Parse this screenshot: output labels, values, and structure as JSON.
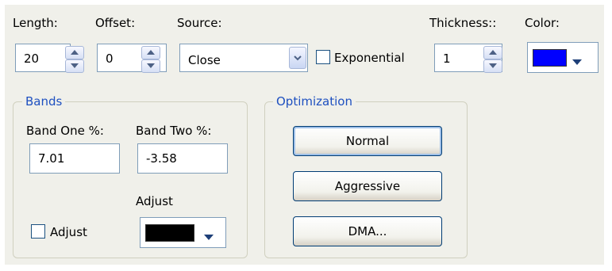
{
  "top": {
    "length": {
      "label": "Length:",
      "value": "20"
    },
    "offset": {
      "label": "Offset:",
      "value": "0"
    },
    "source": {
      "label": "Source:",
      "value": "Close"
    },
    "exponential": {
      "label": "Exponential",
      "checked": false
    },
    "thickness": {
      "label": "Thickness::",
      "value": "1"
    },
    "color": {
      "label": "Color:",
      "value": "#0000ff"
    }
  },
  "bands": {
    "title": "Bands",
    "band_one": {
      "label": "Band One %:",
      "value": "7.01"
    },
    "band_two": {
      "label": "Band Two %:",
      "value": "-3.58"
    },
    "adjust_check": {
      "label": "Adjust",
      "checked": false
    },
    "adjust_color": {
      "label": "Adjust",
      "value": "#000000"
    }
  },
  "optimization": {
    "title": "Optimization",
    "buttons": [
      "Normal",
      "Aggressive",
      "DMA..."
    ]
  }
}
